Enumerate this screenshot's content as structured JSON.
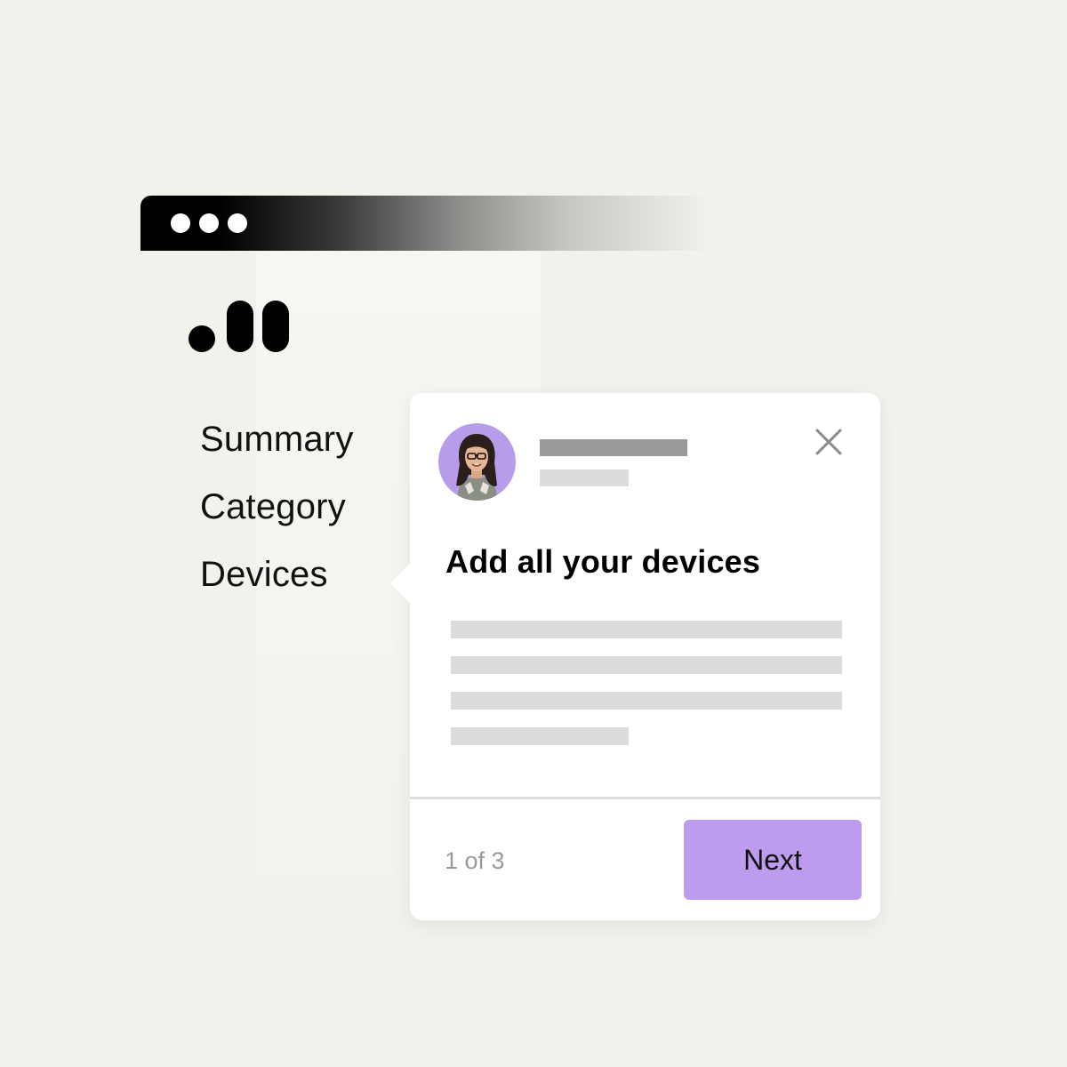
{
  "window": {
    "controls": [
      "dot",
      "dot",
      "dot"
    ]
  },
  "nav": {
    "items": [
      {
        "label": "Summary"
      },
      {
        "label": "Category"
      },
      {
        "label": "Devices"
      }
    ]
  },
  "tour_popover": {
    "title": "Add all your devices",
    "step_counter": "1 of 3",
    "next_label": "Next",
    "close_icon": "close-icon",
    "avatar_icon": "user-avatar"
  },
  "colors": {
    "background": "#f3f1ec",
    "accent": "#bd9cf0",
    "avatar_bg": "#b79de9",
    "placeholder": "#dcdcdc",
    "placeholder_dark": "#9a9a9a"
  }
}
